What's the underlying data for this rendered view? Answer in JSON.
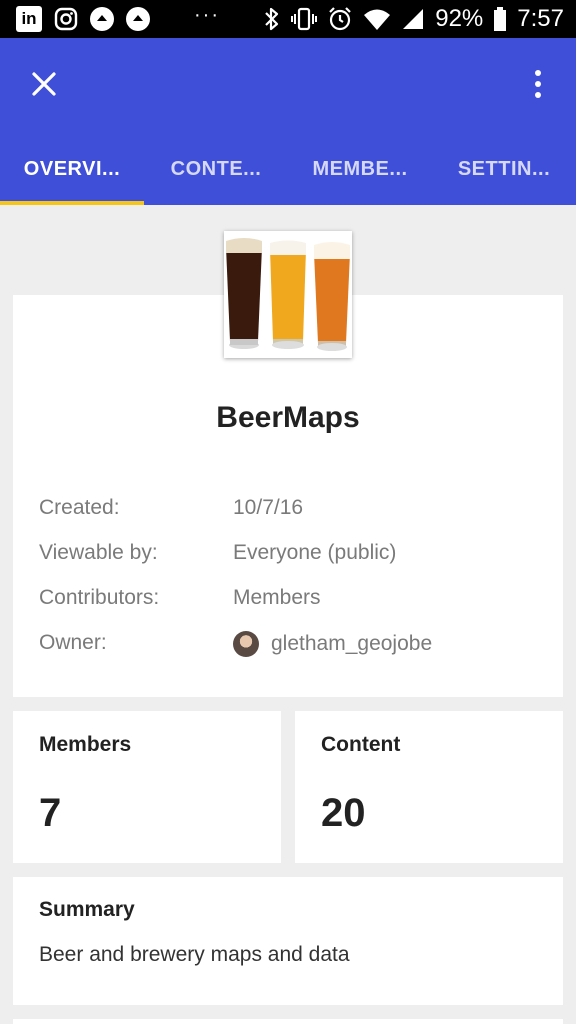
{
  "status_bar": {
    "battery": "92%",
    "time": "7:57",
    "dots": "···",
    "li_text": "in",
    "icons": [
      "linkedin-icon",
      "instagram-icon",
      "notification-icon",
      "notification-icon",
      "bluetooth-icon",
      "vibrate-icon",
      "alarm-icon",
      "wifi-icon",
      "signal-icon",
      "battery-icon"
    ]
  },
  "app_bar": {
    "color": "#3f4fd8",
    "tabs": [
      {
        "label": "OVERVI...",
        "active": true
      },
      {
        "label": "CONTE..."
      },
      {
        "label": "MEMBE..."
      },
      {
        "label": "SETTIN..."
      }
    ],
    "indicator_color": "#f5c518"
  },
  "group": {
    "title": "BeerMaps",
    "details": [
      {
        "label": "Created:",
        "value": "10/7/16"
      },
      {
        "label": "Viewable by:",
        "value": "Everyone (public)"
      },
      {
        "label": "Contributors:",
        "value": "Members"
      },
      {
        "label": "Owner:",
        "value": "gletham_geojobe"
      }
    ]
  },
  "stats": {
    "members_label": "Members",
    "members_value": "7",
    "content_label": "Content",
    "content_value": "20"
  },
  "summary": {
    "label": "Summary",
    "text": "Beer and brewery maps and data"
  }
}
